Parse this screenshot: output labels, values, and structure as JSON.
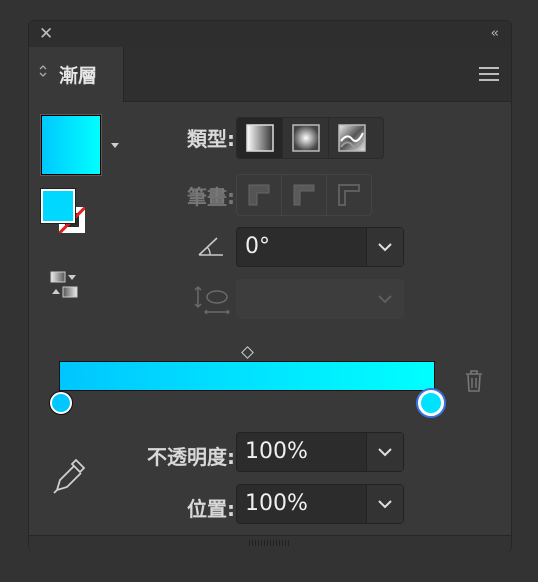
{
  "panel": {
    "tab_label": "漸層",
    "close_glyph": "✕",
    "collapse_glyph": "‹‹"
  },
  "labels": {
    "type": "類型:",
    "stroke": "筆畫:",
    "opacity": "不透明度:",
    "location": "位置:"
  },
  "angle": {
    "value": "0°"
  },
  "aspect": {
    "value": ""
  },
  "opacity": {
    "value": "100%"
  },
  "location": {
    "value": "100%"
  },
  "colors": {
    "gradient_start": "#00c6ff",
    "gradient_end": "#00ffff",
    "accent": "#3a73e6"
  },
  "icons": [
    "close-icon",
    "collapse-icon",
    "panel-menu-icon",
    "swatch-dropdown-icon",
    "reverse-gradient-icon",
    "linear-gradient-icon",
    "radial-gradient-icon",
    "freeform-gradient-icon",
    "stroke-within-icon",
    "stroke-along-icon",
    "stroke-across-icon",
    "angle-icon",
    "aspect-ratio-icon",
    "trash-icon",
    "eyedropper-icon",
    "chevron-down-icon"
  ]
}
